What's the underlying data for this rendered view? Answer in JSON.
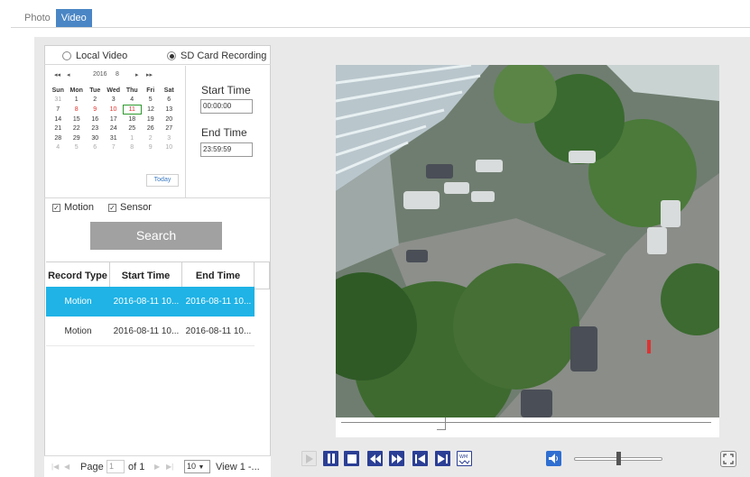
{
  "tabs": [
    {
      "label": "Photo"
    },
    {
      "label": "Video"
    }
  ],
  "source": {
    "local_label": "Local Video",
    "sd_label": "SD Card Recording",
    "selected": "SD Card Recording"
  },
  "calendar": {
    "nav_prev_year": "◂◂",
    "nav_prev_month": "◂",
    "year": "2016",
    "month": "8",
    "nav_next_month": "▸",
    "nav_next_year": "▸▸",
    "weekdays": [
      "Sun",
      "Mon",
      "Tue",
      "Wed",
      "Thu",
      "Fri",
      "Sat"
    ],
    "weeks": [
      [
        "31",
        "1",
        "2",
        "3",
        "4",
        "5",
        "6"
      ],
      [
        "7",
        "8",
        "9",
        "10",
        "11",
        "12",
        "13"
      ],
      [
        "14",
        "15",
        "16",
        "17",
        "18",
        "19",
        "20"
      ],
      [
        "21",
        "22",
        "23",
        "24",
        "25",
        "26",
        "27"
      ],
      [
        "28",
        "29",
        "30",
        "31",
        "1",
        "2",
        "3"
      ],
      [
        "4",
        "5",
        "6",
        "7",
        "8",
        "9",
        "10"
      ]
    ],
    "selected_day": "11",
    "recorded_days": [
      "8",
      "9",
      "10",
      "11"
    ],
    "today_label": "Today"
  },
  "times": {
    "start_label": "Start Time",
    "start_value": "00:00:00",
    "end_label": "End Time",
    "end_value": "23:59:59"
  },
  "filters": {
    "motion_label": "Motion",
    "motion_checked": true,
    "sensor_label": "Sensor",
    "sensor_checked": true
  },
  "search_label": "Search",
  "table": {
    "columns": [
      "Record Type",
      "Start Time",
      "End Time"
    ],
    "rows": [
      {
        "type": "Motion",
        "start": "2016-08-11 10...",
        "end": "2016-08-11 10...",
        "selected": true
      },
      {
        "type": "Motion",
        "start": "2016-08-11 10...",
        "end": "2016-08-11 10...",
        "selected": false
      }
    ]
  },
  "pager": {
    "page_label": "Page",
    "page_value": "1",
    "of_label": "of 1",
    "per_page": "10",
    "view_label": "View 1 -..."
  },
  "playback": {
    "volume_level": 0.5,
    "timeline_position": 0.28
  },
  "colors": {
    "accent": "#1fb3e6",
    "control": "#2b3f95",
    "tab_active": "#4a86c5"
  }
}
